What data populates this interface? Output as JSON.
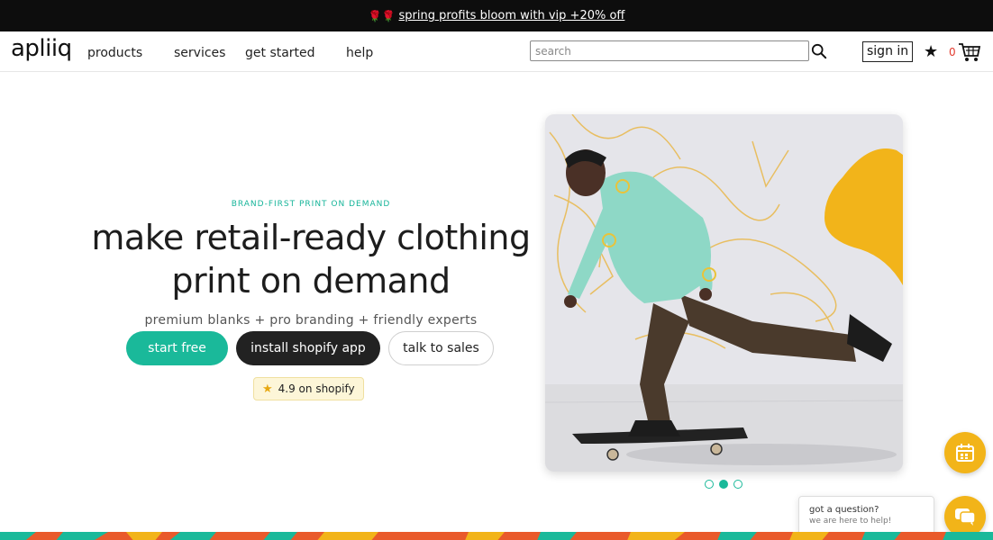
{
  "promo": {
    "emoji": "🌹🌹",
    "text": "spring profits bloom with vip +20% off"
  },
  "nav": {
    "logo": "apliiq",
    "items": [
      "products",
      "services",
      "get started",
      "help"
    ],
    "search_placeholder": "search",
    "sign_in": "sign in",
    "cart_count": "0"
  },
  "hero": {
    "eyebrow": "BRAND-FIRST PRINT ON DEMAND",
    "headline_line1": "make retail-ready clothing",
    "headline_line2": "print on demand",
    "subline": "premium blanks + pro branding + friendly experts",
    "buttons": {
      "start": "start free",
      "shopify": "install shopify app",
      "sales": "talk to sales"
    },
    "rating": "4.9 on shopify",
    "carousel_active": 2,
    "carousel_count": 3
  },
  "chat": {
    "title": "got a question?",
    "subtitle": "we are here to help!"
  },
  "colors": {
    "accent": "#1ab99a",
    "dark": "#222222",
    "yellow": "#f2b419"
  }
}
